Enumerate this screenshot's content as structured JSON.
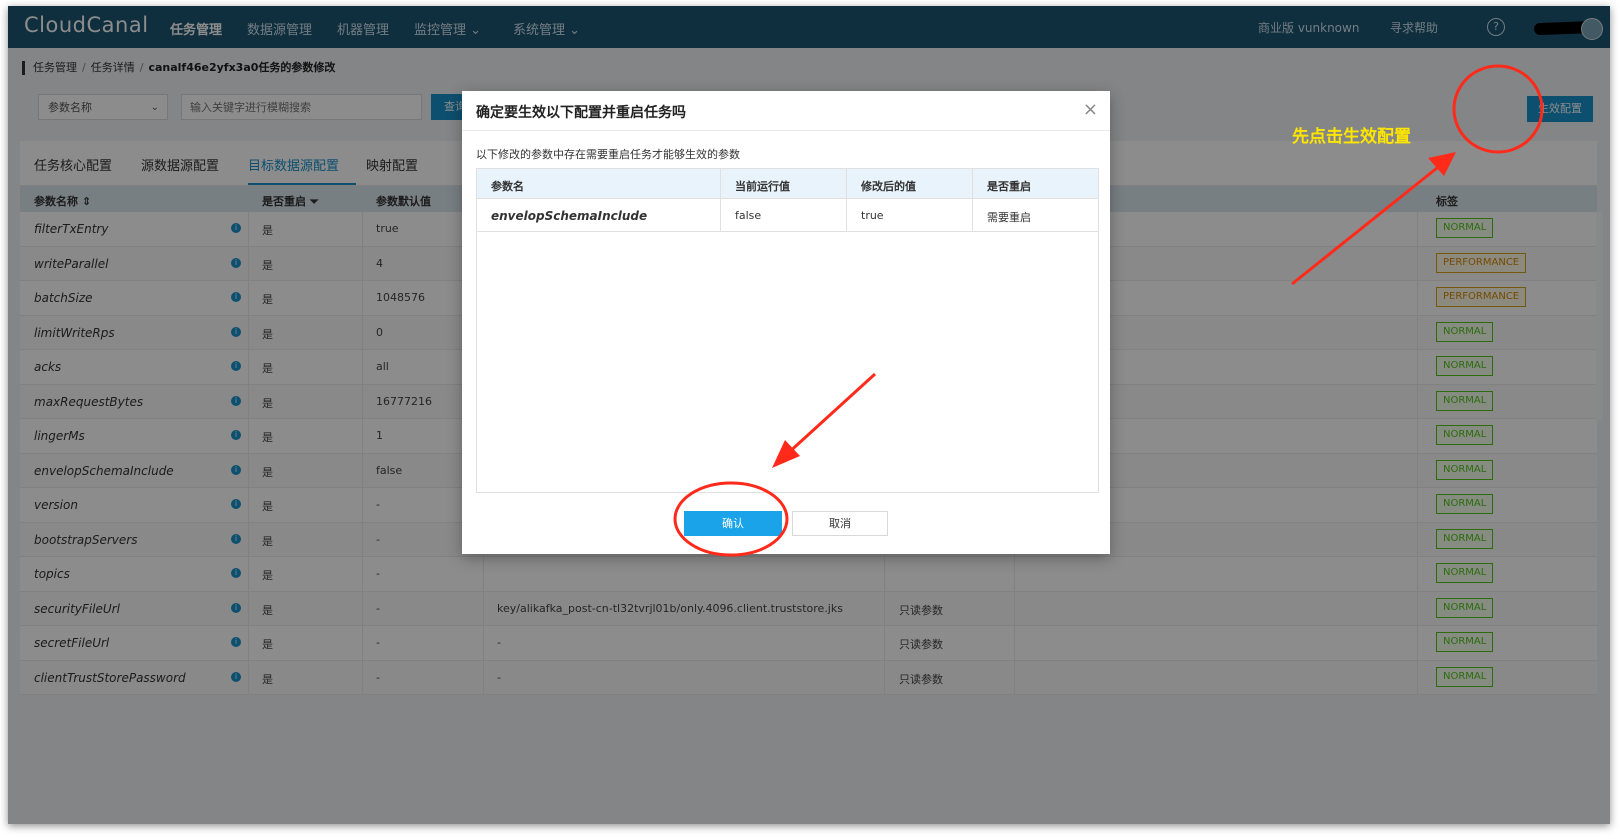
{
  "nav": {
    "logo": "CloudCanal",
    "items": [
      "任务管理",
      "数据源管理",
      "机器管理",
      "监控管理 ⌄",
      "系统管理 ⌄"
    ],
    "edition": "商业版 vunknown",
    "help": "寻求帮助",
    "help_icon": "?"
  },
  "breadcrumb": {
    "items": [
      "任务管理",
      "任务详情",
      "canalf46e2yfx3a0任务的参数修改"
    ],
    "sep": "/"
  },
  "filter": {
    "select_value": "参数名称",
    "search_placeholder": "输入关键字进行模糊搜索",
    "query_label": "查询",
    "apply_label": "生效配置"
  },
  "tabs": [
    "任务核心配置",
    "源数据源配置",
    "目标数据源配置",
    "映射配置"
  ],
  "table": {
    "headers": [
      "参数名称 ⇕",
      "是否重启 ⏷",
      "参数默认值",
      "标签"
    ],
    "rows": [
      {
        "name": "filterTxEntry",
        "restart": "是",
        "default": "true",
        "value": "",
        "type": "",
        "tag": "NORMAL"
      },
      {
        "name": "writeParallel",
        "restart": "是",
        "default": "4",
        "value": "",
        "type": "",
        "tag": "PERFORMANCE"
      },
      {
        "name": "batchSize",
        "restart": "是",
        "default": "1048576",
        "value": "",
        "type": "",
        "tag": "PERFORMANCE"
      },
      {
        "name": "limitWriteRps",
        "restart": "是",
        "default": "0",
        "value": "",
        "type": "",
        "tag": "NORMAL"
      },
      {
        "name": "acks",
        "restart": "是",
        "default": "all",
        "value": "",
        "type": "",
        "tag": "NORMAL"
      },
      {
        "name": "maxRequestBytes",
        "restart": "是",
        "default": "16777216",
        "value": "",
        "type": "",
        "tag": "NORMAL"
      },
      {
        "name": "lingerMs",
        "restart": "是",
        "default": "1",
        "value": "",
        "type": "",
        "tag": "NORMAL"
      },
      {
        "name": "envelopSchemaInclude",
        "restart": "是",
        "default": "false",
        "value": "",
        "type": "",
        "tag": "NORMAL"
      },
      {
        "name": "version",
        "restart": "是",
        "default": "-",
        "value": "",
        "type": "",
        "tag": "NORMAL"
      },
      {
        "name": "bootstrapServers",
        "restart": "是",
        "default": "-",
        "value": "",
        "type": "",
        "tag": "NORMAL"
      },
      {
        "name": "topics",
        "restart": "是",
        "default": "-",
        "value": "",
        "type": "",
        "tag": "NORMAL"
      },
      {
        "name": "securityFileUrl",
        "restart": "是",
        "default": "-",
        "value": "key/alikafka_post-cn-tl32tvrjl01b/only.4096.client.truststore.jks",
        "type": "只读参数",
        "tag": "NORMAL"
      },
      {
        "name": "secretFileUrl",
        "restart": "是",
        "default": "-",
        "value": "-",
        "type": "只读参数",
        "tag": "NORMAL"
      },
      {
        "name": "clientTrustStorePassword",
        "restart": "是",
        "default": "-",
        "value": "-",
        "type": "只读参数",
        "tag": "NORMAL"
      }
    ]
  },
  "modal": {
    "title": "确定要生效以下配置并重启任务吗",
    "close_icon": "×",
    "desc": "以下修改的参数中存在需要重启任务才能够生效的参数",
    "headers": [
      "参数名",
      "当前运行值",
      "修改后的值",
      "是否重启"
    ],
    "row": {
      "name": "envelopSchemaInclude",
      "current": "false",
      "new": "true",
      "restart": "需要重启"
    },
    "confirm_label": "确认",
    "cancel_label": "取消"
  },
  "annotation": {
    "text": "先点击生效配置",
    "color": "#ffe600",
    "arrow_color": "#ff2a1a"
  }
}
